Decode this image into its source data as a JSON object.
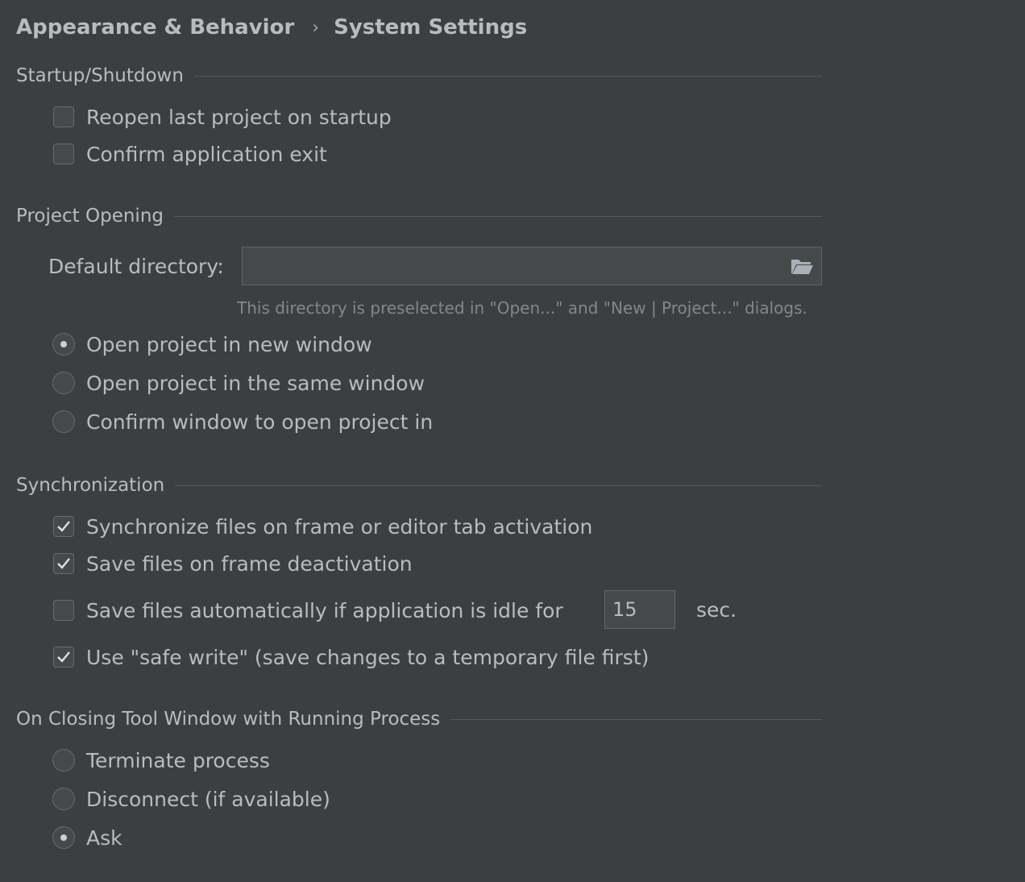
{
  "breadcrumb": {
    "parent": "Appearance & Behavior",
    "separator": "›",
    "current": "System Settings"
  },
  "startup": {
    "title": "Startup/Shutdown",
    "reopen_last_project": {
      "label": "Reopen last project on startup",
      "checked": false
    },
    "confirm_exit": {
      "label": "Confirm application exit",
      "checked": false
    }
  },
  "project_opening": {
    "title": "Project Opening",
    "default_directory_label": "Default directory:",
    "default_directory_value": "",
    "folder_icon": "folder-open-icon",
    "hint": "This directory is preselected in \"Open...\" and \"New | Project...\" dialogs.",
    "options": [
      {
        "label": "Open project in new window",
        "selected": true
      },
      {
        "label": "Open project in the same window",
        "selected": false
      },
      {
        "label": "Confirm window to open project in",
        "selected": false
      }
    ]
  },
  "synchronization": {
    "title": "Synchronization",
    "sync_on_activation": {
      "label": "Synchronize files on frame or editor tab activation",
      "checked": true
    },
    "save_on_deactivation": {
      "label": "Save files on frame deactivation",
      "checked": true
    },
    "save_when_idle": {
      "label": "Save files automatically if application is idle for",
      "checked": false,
      "seconds": "15",
      "unit": "sec."
    },
    "safe_write": {
      "label": "Use \"safe write\" (save changes to a temporary file first)",
      "checked": true
    }
  },
  "closing_tool_window": {
    "title": "On Closing Tool Window with Running Process",
    "options": [
      {
        "label": "Terminate process",
        "selected": false
      },
      {
        "label": "Disconnect (if available)",
        "selected": false
      },
      {
        "label": "Ask",
        "selected": true
      }
    ]
  },
  "colors": {
    "background": "#3c3f41",
    "text": "#bbbbbb",
    "hint": "#868686",
    "control_bg": "#45494a",
    "border": "#646464"
  }
}
